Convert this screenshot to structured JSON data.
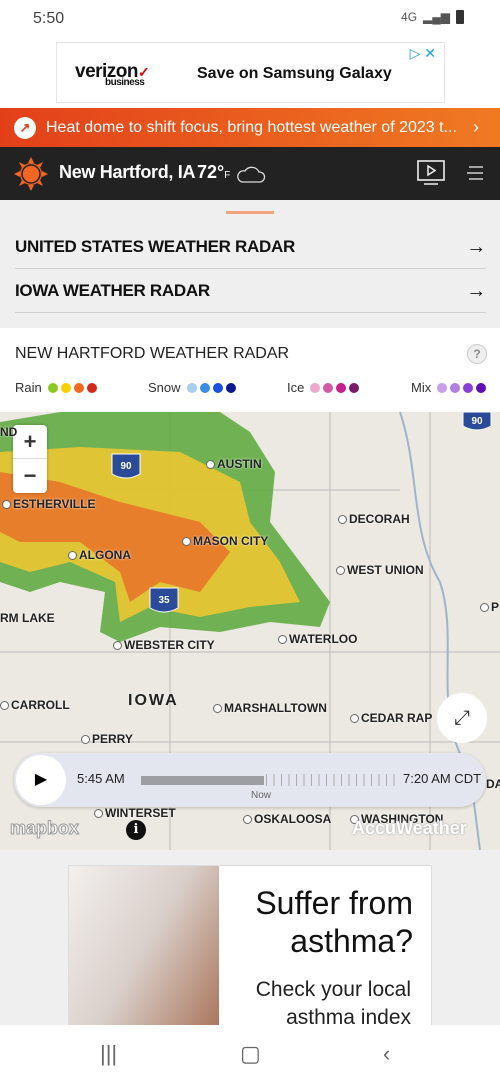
{
  "status_bar": {
    "time": "5:50",
    "network": "4G"
  },
  "top_ad": {
    "brand": "verizon",
    "brand_sub": "business",
    "copy": "Save on Samsung Galaxy"
  },
  "banner": {
    "text": "Heat dome to shift focus, bring hottest weather of 2023 t..."
  },
  "header": {
    "location": "New Hartford, IA",
    "temp": "72°",
    "unit": "F",
    "condition_icon": "cloud-icon",
    "accent": "#f26522"
  },
  "links": [
    {
      "label": "UNITED STATES WEATHER RADAR"
    },
    {
      "label": "IOWA WEATHER RADAR"
    }
  ],
  "radar": {
    "title": "NEW HARTFORD WEATHER RADAR",
    "help": "?",
    "legend": [
      {
        "label": "Rain",
        "colors": [
          "#8cc820",
          "#f8d000",
          "#ef6a1e",
          "#d42a1a"
        ]
      },
      {
        "label": "Snow",
        "colors": [
          "#a8cdf0",
          "#3a8fe0",
          "#1a50e0",
          "#0a1890"
        ]
      },
      {
        "label": "Ice",
        "colors": [
          "#eaa8cc",
          "#d45aa8",
          "#c41e90",
          "#7a1a68"
        ]
      },
      {
        "label": "Mix",
        "colors": [
          "#c8a0ea",
          "#b080e0",
          "#8a40d8",
          "#6010b0"
        ]
      }
    ],
    "map": {
      "zoom_in": "+",
      "zoom_out": "−",
      "highways": [
        "90",
        "35",
        "90"
      ],
      "cities": [
        "AUSTIN",
        "ESTHERVILLE",
        "DECORAH",
        "ALGONA",
        "MASON CITY",
        "WEST UNION",
        "RM LAKE",
        "WEBSTER CITY",
        "WATERLOO",
        "IOWA",
        "CARROLL",
        "MARSHALLTOWN",
        "CEDAR RAP",
        "PERRY",
        "WINTERSET",
        "OSKALOOSA",
        "WASHINGTON",
        "ND",
        "DA",
        "P"
      ],
      "attribution": "mapbox",
      "watermark": "AccuWeather"
    },
    "timeline": {
      "start": "5:45 AM",
      "end": "7:20 AM CDT",
      "now_label": "Now",
      "progress_percent": 49
    }
  },
  "bottom_ad": {
    "headline": "Suffer from asthma?",
    "sub": "Check your local asthma index"
  }
}
